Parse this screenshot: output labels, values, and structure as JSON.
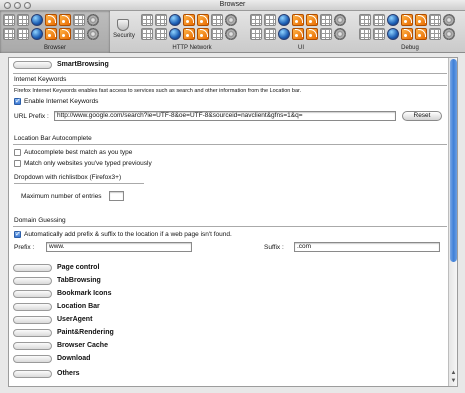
{
  "window": {
    "title": "Browser"
  },
  "toolbar": {
    "groups": [
      {
        "label": "Browser"
      },
      {
        "label": "Security"
      },
      {
        "label": "HTTP Network"
      },
      {
        "label": "UI"
      },
      {
        "label": "Debug"
      }
    ]
  },
  "sections": {
    "smart_browsing": "SmartBrowsing",
    "internet_keywords": {
      "heading": "Internet Keywords",
      "description": "Firefox Internet Keywords enables fast access to services such as search and other information from the Location bar.",
      "enable_label": "Enable Internet Keywords",
      "enable_checked": true,
      "url_prefix_label": "URL Prefix :",
      "url_prefix_value": "http://www.google.com/search?ie=UTF-8&oe=UTF-8&sourceid=navclient&gfns=1&q=",
      "reset_label": "Reset"
    },
    "location_bar_autocomplete": {
      "heading": "Location Bar Autocomplete",
      "best_match_label": "Autocomplete best match as you type",
      "best_match_checked": false,
      "typed_label": "Match only websites you've typed previously",
      "typed_checked": false,
      "dropdown_heading": "Dropdown with richlistbox (Firefox3+)",
      "max_entries_label": "Maximum number of entries",
      "max_entries_value": ""
    },
    "domain_guessing": {
      "heading": "Domain Guessing",
      "auto_label": "Automatically add prefix & suffix to the location if a web page isn't found.",
      "auto_checked": true,
      "prefix_label": "Prefix :",
      "prefix_value": "www.",
      "suffix_label": "Suffix :",
      "suffix_value": ".com"
    },
    "collapsed": [
      "Page control",
      "TabBrowsing",
      "Bookmark Icons",
      "Location Bar",
      "UserAgent",
      "Paint&Rendering",
      "Browser Cache",
      "Download",
      "Others"
    ]
  }
}
